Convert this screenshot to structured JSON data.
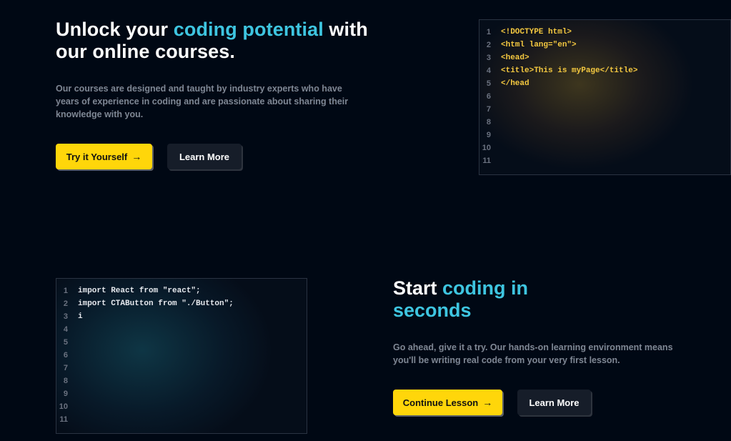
{
  "hero": {
    "title_part1": "Unlock your ",
    "title_highlight": "coding potential",
    "title_part2": " with our online courses.",
    "description": "Our courses are designed and taught by industry experts who have years of experience in coding and are passionate about sharing their knowledge with you.",
    "primary_button": "Try it Yourself",
    "secondary_button": "Learn More"
  },
  "code1": {
    "lines": [
      {
        "n": "1",
        "text": "<!DOCTYPE html>"
      },
      {
        "n": "2",
        "text": "<html lang=\"en\">"
      },
      {
        "n": "3",
        "text": "<head>"
      },
      {
        "n": "4",
        "text": "<title>This is myPage</title>"
      },
      {
        "n": "5",
        "text": "</head"
      },
      {
        "n": "6",
        "text": ""
      },
      {
        "n": "7",
        "text": ""
      },
      {
        "n": "8",
        "text": ""
      },
      {
        "n": "9",
        "text": ""
      },
      {
        "n": "10",
        "text": ""
      },
      {
        "n": "11",
        "text": ""
      }
    ]
  },
  "section2": {
    "title_part1": "Start ",
    "title_highlight": "coding in seconds",
    "description": "Go ahead, give it a try. Our hands-on learning environment means you'll be writing real code from your very first lesson.",
    "primary_button": "Continue Lesson",
    "secondary_button": "Learn More"
  },
  "code2": {
    "lines": [
      {
        "n": "1",
        "text": "import React from \"react\";"
      },
      {
        "n": "2",
        "text": "import CTAButton from \"./Button\";"
      },
      {
        "n": "3",
        "text": "i"
      },
      {
        "n": "4",
        "text": ""
      },
      {
        "n": "5",
        "text": ""
      },
      {
        "n": "6",
        "text": ""
      },
      {
        "n": "7",
        "text": ""
      },
      {
        "n": "8",
        "text": ""
      },
      {
        "n": "9",
        "text": ""
      },
      {
        "n": "10",
        "text": ""
      },
      {
        "n": "11",
        "text": ""
      }
    ]
  },
  "icons": {
    "arrow": "arrow-right-icon"
  },
  "colors": {
    "background": "#000814",
    "accent_blue": "#3ec5e0",
    "accent_yellow": "#ffd60a",
    "code_yellow": "#f5c940",
    "text_muted": "#7f8794"
  }
}
